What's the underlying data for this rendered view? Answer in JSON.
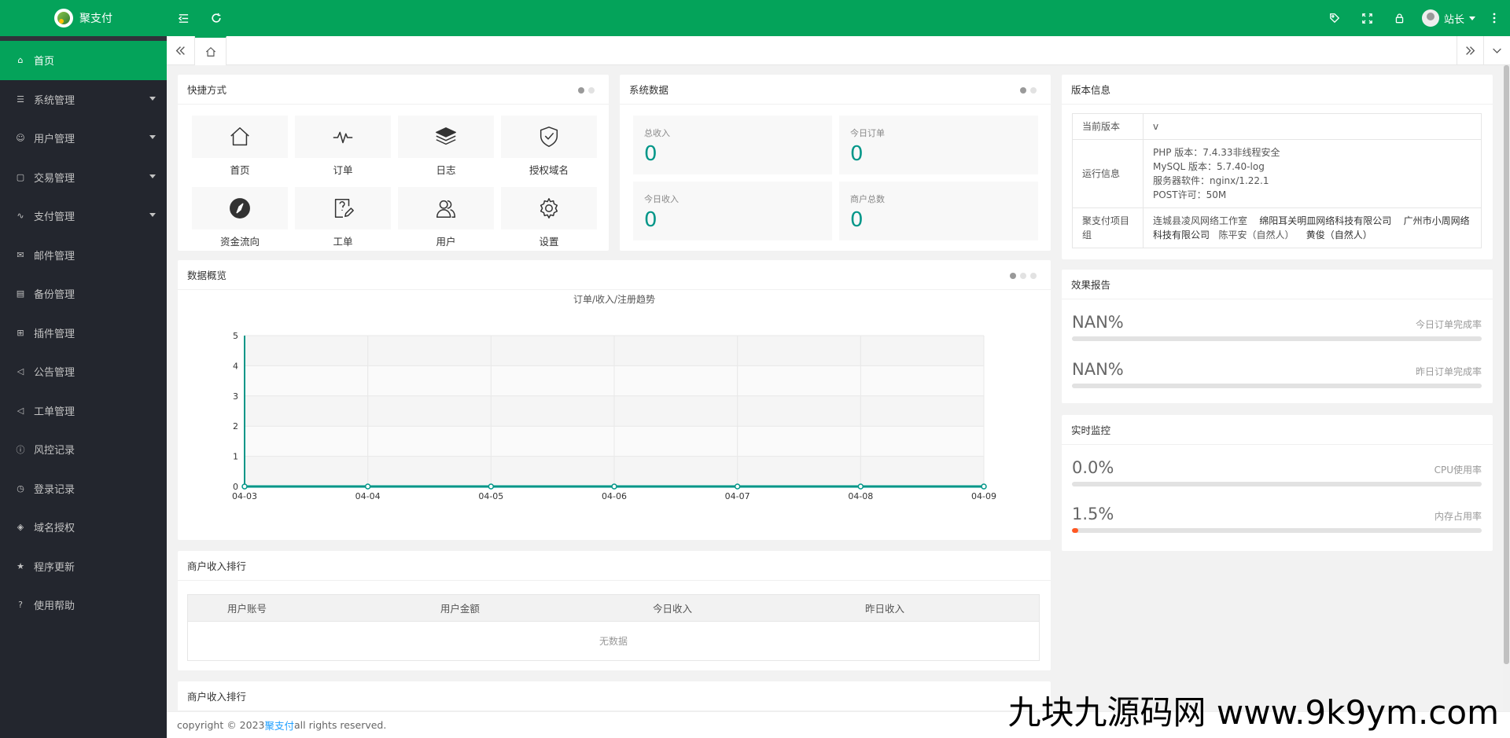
{
  "app": {
    "name": "聚支付"
  },
  "header": {
    "user_name": "站长"
  },
  "sidebar": {
    "items": [
      {
        "label": "首页",
        "icon": "⌂",
        "active": true,
        "has_children": false
      },
      {
        "label": "系统管理",
        "icon": "☰",
        "has_children": true
      },
      {
        "label": "用户管理",
        "icon": "☺",
        "has_children": true
      },
      {
        "label": "交易管理",
        "icon": "▢",
        "has_children": true
      },
      {
        "label": "支付管理",
        "icon": "∿",
        "has_children": true
      },
      {
        "label": "邮件管理",
        "icon": "✉",
        "has_children": false
      },
      {
        "label": "备份管理",
        "icon": "▤",
        "has_children": false
      },
      {
        "label": "插件管理",
        "icon": "⊞",
        "has_children": false
      },
      {
        "label": "公告管理",
        "icon": "◁",
        "has_children": false
      },
      {
        "label": "工单管理",
        "icon": "◁",
        "has_children": false
      },
      {
        "label": "风控记录",
        "icon": "ⓘ",
        "has_children": false
      },
      {
        "label": "登录记录",
        "icon": "◷",
        "has_children": false
      },
      {
        "label": "域名授权",
        "icon": "◈",
        "has_children": false
      },
      {
        "label": "程序更新",
        "icon": "★",
        "has_children": false
      },
      {
        "label": "使用帮助",
        "icon": "?",
        "has_children": false
      }
    ]
  },
  "quick": {
    "title": "快捷方式",
    "items": [
      {
        "label": "首页",
        "icon": "home-icon"
      },
      {
        "label": "订单",
        "icon": "pulse-icon"
      },
      {
        "label": "日志",
        "icon": "layers-icon"
      },
      {
        "label": "授权域名",
        "icon": "shield-check-icon"
      },
      {
        "label": "资金流向",
        "icon": "compass-icon"
      },
      {
        "label": "工单",
        "icon": "help-edit-icon"
      },
      {
        "label": "用户",
        "icon": "users-icon"
      },
      {
        "label": "设置",
        "icon": "gear-icon"
      }
    ]
  },
  "sysdata": {
    "title": "系统数据",
    "stats": [
      {
        "label": "总收入",
        "value": "0"
      },
      {
        "label": "今日订单",
        "value": "0"
      },
      {
        "label": "今日收入",
        "value": "0"
      },
      {
        "label": "商户总数",
        "value": "0"
      }
    ]
  },
  "version": {
    "title": "版本信息",
    "current_label": "当前版本",
    "current_value": "v",
    "runtime_label": "运行信息",
    "runtime_lines": [
      "PHP 版本：7.4.33非线程安全",
      "MySQL 版本：5.7.40-log",
      "服务器软件：nginx/1.22.1",
      "POST许可：50M"
    ],
    "team_label": "聚支付项目组",
    "team_members": [
      "连城县凌风网络工作室",
      "绵阳耳关明皿网络科技有限公司",
      "广州市小周网络科技有限公司",
      "陈平安（自然人）",
      "黄俊（自然人）"
    ]
  },
  "effect": {
    "title": "效果报告",
    "rows": [
      {
        "value": "NAN%",
        "label": "今日订单完成率",
        "percent": 0
      },
      {
        "value": "NAN%",
        "label": "昨日订单完成率",
        "percent": 0
      }
    ]
  },
  "monitor": {
    "title": "实时监控",
    "rows": [
      {
        "value": "0.0%",
        "label": "CPU使用率",
        "percent": 0.0
      },
      {
        "value": "1.5%",
        "label": "内存占用率",
        "percent": 1.5
      }
    ]
  },
  "overview": {
    "title": "数据概览"
  },
  "chart_data": {
    "type": "line",
    "title": "订单/收入/注册趋势",
    "x": [
      "04-03",
      "04-04",
      "04-05",
      "04-06",
      "04-07",
      "04-08",
      "04-09"
    ],
    "series": [
      {
        "values": [
          0,
          0,
          0,
          0,
          0,
          0,
          0
        ],
        "color": "#009688"
      }
    ],
    "ylim": [
      0,
      5
    ],
    "yticks": [
      0,
      1,
      2,
      3,
      4,
      5
    ],
    "grid": true
  },
  "ranking": {
    "title": "商户收入排行",
    "columns": [
      "用户账号",
      "用户金额",
      "今日收入",
      "昨日收入"
    ],
    "empty_text": "无数据",
    "second_title": "商户收入排行"
  },
  "footer": {
    "prefix": "copyright © 2023 ",
    "link": "聚支付",
    "suffix": " all rights reserved."
  },
  "watermark": "九块九源码网 www.9k9ym.com",
  "colors": {
    "brand": "#04a35a",
    "sidebar": "#23262e",
    "accent": "#009688",
    "progress": "#ff5722"
  }
}
